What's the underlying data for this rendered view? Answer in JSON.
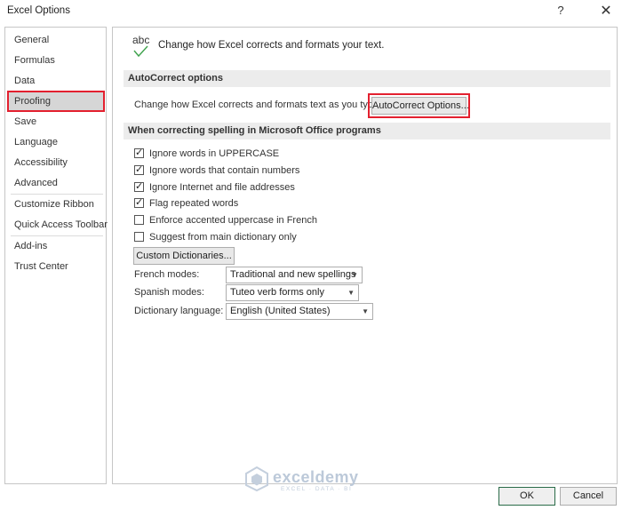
{
  "window": {
    "title": "Excel Options",
    "help_glyph": "?",
    "close_glyph": "✕"
  },
  "sidebar": {
    "items": [
      {
        "label": "General"
      },
      {
        "label": "Formulas"
      },
      {
        "label": "Data"
      },
      {
        "label": "Proofing",
        "selected": true
      },
      {
        "label": "Save"
      },
      {
        "label": "Language"
      },
      {
        "label": "Accessibility"
      },
      {
        "label": "Advanced"
      },
      {
        "label": "Customize Ribbon"
      },
      {
        "label": "Quick Access Toolbar"
      },
      {
        "label": "Add-ins"
      },
      {
        "label": "Trust Center"
      }
    ]
  },
  "main": {
    "header_icon_text": "abc",
    "header_text": "Change how Excel corrects and formats your text.",
    "autocorrect": {
      "section_title": "AutoCorrect options",
      "description": "Change how Excel corrects and formats text as you type:",
      "button_label": "AutoCorrect Options..."
    },
    "spelling": {
      "section_title": "When correcting spelling in Microsoft Office programs",
      "options": [
        {
          "label": "Ignore words in UPPERCASE",
          "checked": true
        },
        {
          "label": "Ignore words that contain numbers",
          "checked": true
        },
        {
          "label": "Ignore Internet and file addresses",
          "checked": true
        },
        {
          "label": "Flag repeated words",
          "checked": true
        },
        {
          "label": "Enforce accented uppercase in French",
          "checked": false
        },
        {
          "label": "Suggest from main dictionary only",
          "checked": false
        }
      ],
      "custom_dictionaries_label": "Custom Dictionaries...",
      "french_modes": {
        "label": "French modes:",
        "value": "Traditional and new spellings"
      },
      "spanish_modes": {
        "label": "Spanish modes:",
        "value": "Tuteo verb forms only"
      },
      "dictionary_language": {
        "label": "Dictionary language:",
        "value": "English (United States)"
      }
    }
  },
  "watermark": {
    "name": "exceldemy",
    "tagline": "EXCEL · DATA · BI"
  },
  "footer": {
    "ok_label": "OK",
    "cancel_label": "Cancel"
  },
  "colors": {
    "highlight": "#e3202f",
    "selected_bg": "#d6d6d6",
    "section_bg": "#ececec"
  }
}
